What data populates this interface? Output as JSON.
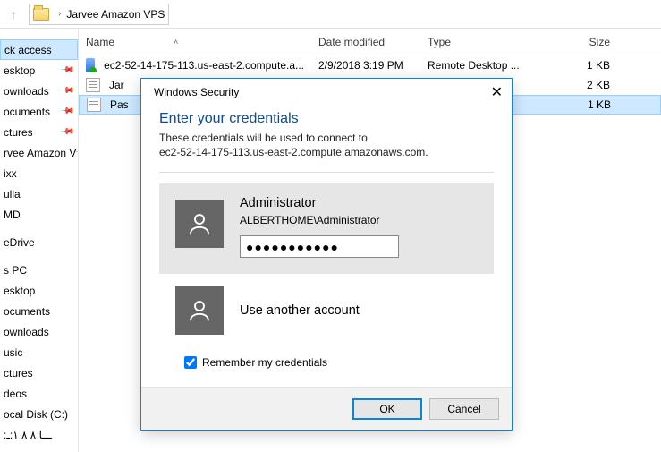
{
  "addr": {
    "folder": "Jarvee Amazon VPS"
  },
  "sidebar": {
    "groups": {
      "quick": {
        "label": "ck access",
        "items": [
          {
            "label": "esktop",
            "pin": true
          },
          {
            "label": "ownloads",
            "pin": true
          },
          {
            "label": "ocuments",
            "pin": true
          },
          {
            "label": "ctures",
            "pin": true
          },
          {
            "label": "rvee Amazon V",
            "pin": true
          },
          {
            "label": "ixx",
            "pin": false
          },
          {
            "label": "ulla",
            "pin": false
          },
          {
            "label": "MD",
            "pin": false
          }
        ]
      },
      "onedrive": {
        "label": "eDrive"
      },
      "pc": {
        "label": "s PC",
        "items": [
          {
            "label": "esktop"
          },
          {
            "label": "ocuments"
          },
          {
            "label": "ownloads"
          },
          {
            "label": "usic"
          },
          {
            "label": "ctures"
          },
          {
            "label": "deos"
          },
          {
            "label": "ocal Disk (C:)"
          },
          {
            "label": ":ـــا ٨ ٨ ١:ـ"
          }
        ]
      }
    }
  },
  "columns": {
    "name": "Name",
    "date": "Date modified",
    "type": "Type",
    "size": "Size"
  },
  "files": [
    {
      "name": "ec2-52-14-175-113.us-east-2.compute.a...",
      "date": "2/9/2018 3:19 PM",
      "type": "Remote Desktop ...",
      "size": "1 KB",
      "icon": "rdp",
      "sel": false
    },
    {
      "name": "Jar",
      "date": "",
      "type": "",
      "size": "2 KB",
      "icon": "txt",
      "sel": false
    },
    {
      "name": "Pas",
      "date": "",
      "type": "",
      "size": "1 KB",
      "icon": "txt",
      "sel": true
    }
  ],
  "dialog": {
    "title": "Windows Security",
    "heading": "Enter your credentials",
    "sub1": "These credentials will be used to connect to",
    "sub2": "ec2-52-14-175-113.us-east-2.compute.amazonaws.com.",
    "acct_name": "Administrator",
    "acct_domain": "ALBERTHOME\\Administrator",
    "password": "●●●●●●●●●●●",
    "use_other": "Use another account",
    "remember": "Remember my credentials",
    "ok": "OK",
    "cancel": "Cancel"
  }
}
